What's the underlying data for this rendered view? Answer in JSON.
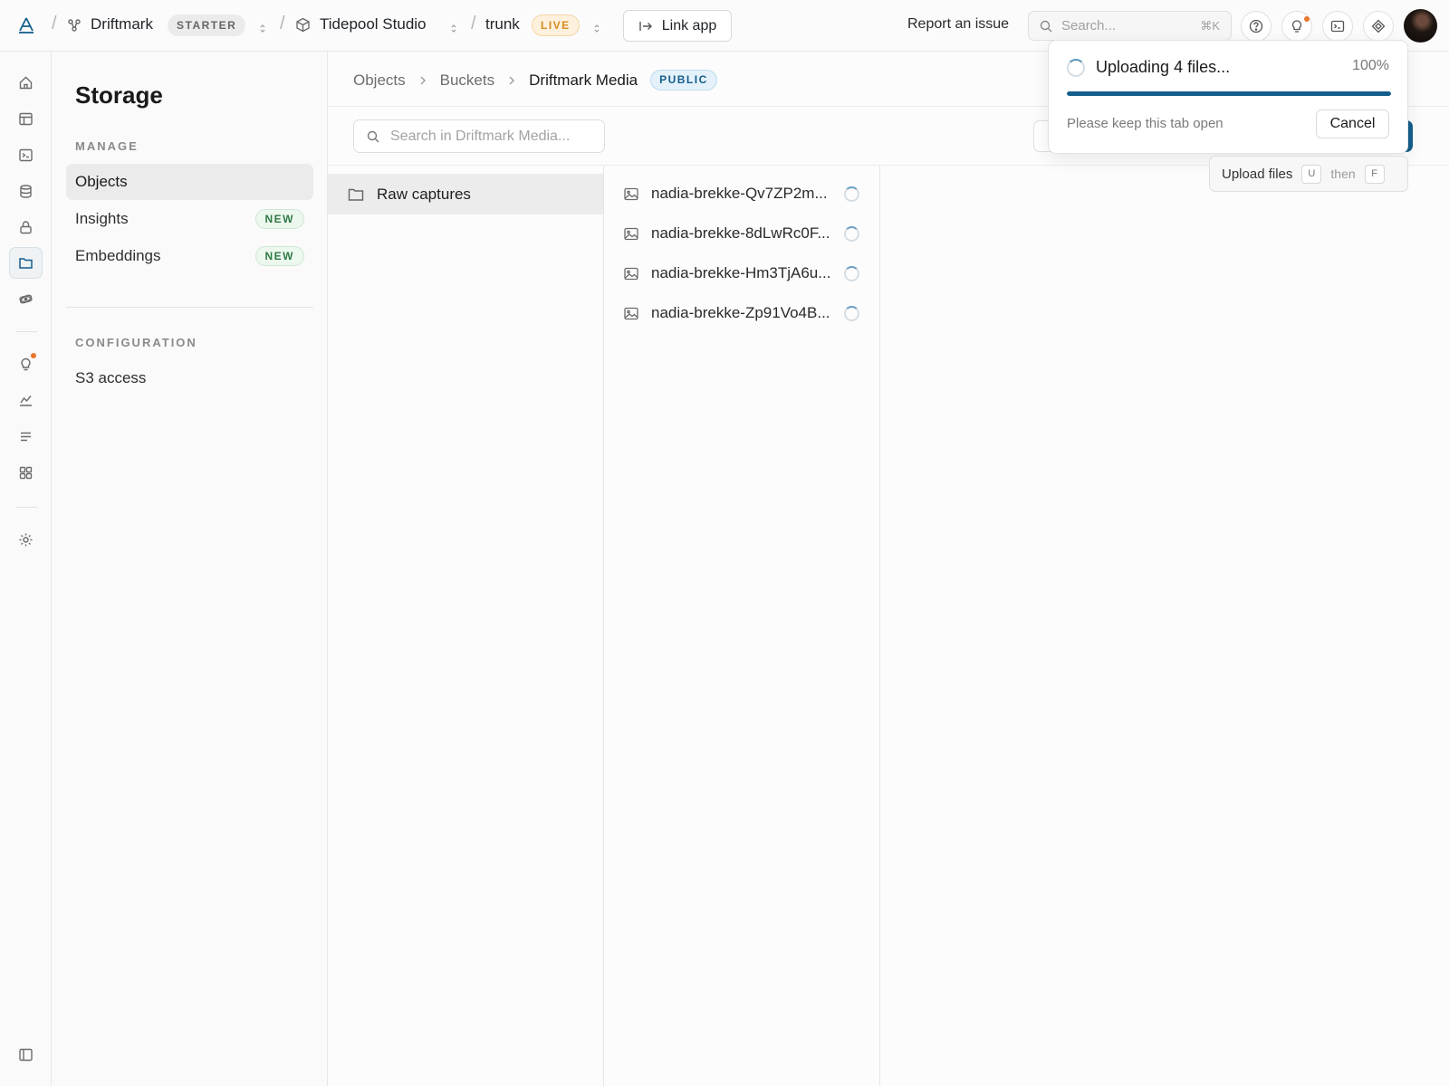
{
  "topbar": {
    "org_name": "Driftmark",
    "org_plan": "STARTER",
    "project_name": "Tidepool Studio",
    "branch_name": "trunk",
    "branch_status": "LIVE",
    "link_app_label": "Link app",
    "report_label": "Report an issue",
    "search_placeholder": "Search...",
    "search_shortcut": "⌘K",
    "separator": "/"
  },
  "sidebar": {
    "title": "Storage",
    "manage_label": "MANAGE",
    "manage_items": [
      {
        "label": "Objects",
        "active": true
      },
      {
        "label": "Insights",
        "badge": "NEW"
      },
      {
        "label": "Embeddings",
        "badge": "NEW"
      }
    ],
    "config_label": "CONFIGURATION",
    "config_items": [
      {
        "label": "S3 access"
      }
    ]
  },
  "main": {
    "breadcrumb": [
      "Objects",
      "Buckets",
      "Driftmark Media"
    ],
    "bucket_visibility": "PUBLIC",
    "search_placeholder": "Search in Driftmark Media...",
    "folders": [
      {
        "name": "Raw captures",
        "selected": true
      }
    ],
    "files": [
      {
        "name": "nadia-brekke-Qv7ZP2m..."
      },
      {
        "name": "nadia-brekke-8dLwRc0F..."
      },
      {
        "name": "nadia-brekke-Hm3TjA6u..."
      },
      {
        "name": "nadia-brekke-Zp91Vo4B..."
      }
    ]
  },
  "upload": {
    "title": "Uploading 4 files...",
    "percent_label": "100%",
    "progress": 1.0,
    "note": "Please keep this tab open",
    "cancel_label": "Cancel"
  },
  "tooltip": {
    "label": "Upload files",
    "key1": "U",
    "then": "then",
    "key2": "F"
  },
  "colors": {
    "accent": "#155e8c",
    "live": "#d98a1f",
    "new_badge": "#2f7a45",
    "notification_dot": "#e9762b"
  }
}
